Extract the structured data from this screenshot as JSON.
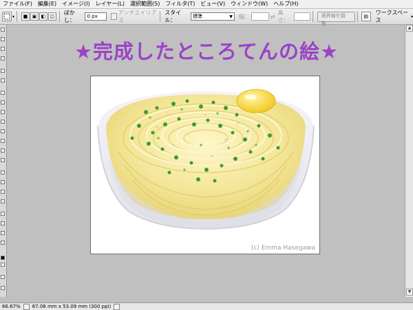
{
  "menu": {
    "items": [
      "ファイル(F)",
      "編集(E)",
      "イメージ(I)",
      "レイヤー(L)",
      "選択範囲(S)",
      "フィルタ(T)",
      "ビュー(V)",
      "ウィンドウ(W)",
      "ヘルプ(H)"
    ]
  },
  "options_bar": {
    "feather_label": "ぼかし：",
    "feather_value": "0 px",
    "antialias_label": "アンチエイリアス",
    "style_label": "スタイル：",
    "style_value": "標準",
    "width_label": "幅：",
    "height_label": "高さ：",
    "refine_edge_label": "境界線を調整...",
    "workspace_label": "ワークスペース"
  },
  "document": {
    "title": "★完成したところてんの絵★",
    "credit": "(c) Emma Hasegawa"
  },
  "status_bar": {
    "zoom": "66.67%",
    "doc_info": "67.06 mm x 53.09 mm (300 ppi)"
  },
  "colors": {
    "title_purple": "#9b43c8",
    "background_gray": "#c0c0c0"
  }
}
